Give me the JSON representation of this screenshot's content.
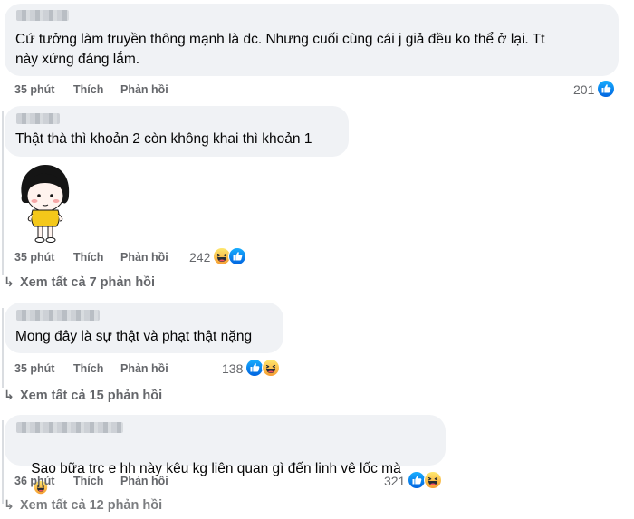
{
  "comments": [
    {
      "text": "Cứ tưởng làm truyền thông mạnh là dc. Nhưng cuối cùng cái j giả đều ko thể ở lại. Tt\nnày xứng đáng lắm.",
      "time": "35 phút",
      "like_label": "Thích",
      "reply_label": "Phản hồi",
      "reaction_count": "201",
      "reactions": [
        "like-icon"
      ]
    },
    {
      "text": "Thật thà thì khoản 2 còn không khai thì khoản 1",
      "sticker": "girl-sticker-icon",
      "time": "35 phút",
      "like_label": "Thích",
      "reply_label": "Phản hồi",
      "reaction_count": "242",
      "reactions": [
        "haha-icon",
        "like-icon"
      ],
      "view_replies": "Xem tất cả 7 phản hồi"
    },
    {
      "text": "Mong đây là sự thật và phạt thật nặng",
      "time": "35 phút",
      "like_label": "Thích",
      "reply_label": "Phản hồi",
      "reaction_count": "138",
      "reactions": [
        "like-icon",
        "haha-icon"
      ],
      "view_replies": "Xem tất cả 15 phản hồi"
    },
    {
      "text": "Sao bữa trc e hh này kêu kg liên quan gì đến linh vê lốc mà",
      "inline_emoji": "😂",
      "time": "36 phút",
      "like_label": "Thích",
      "reply_label": "Phản hồi",
      "reaction_count": "321",
      "reactions": [
        "like-icon",
        "haha-icon"
      ],
      "view_replies": "Xem tất cả 12 phản hồi"
    }
  ],
  "colors": {
    "bubble": "#f0f2f5",
    "meta": "#65676b",
    "like_blue": "#1877f2",
    "haha_yellow": "#f7b125"
  }
}
